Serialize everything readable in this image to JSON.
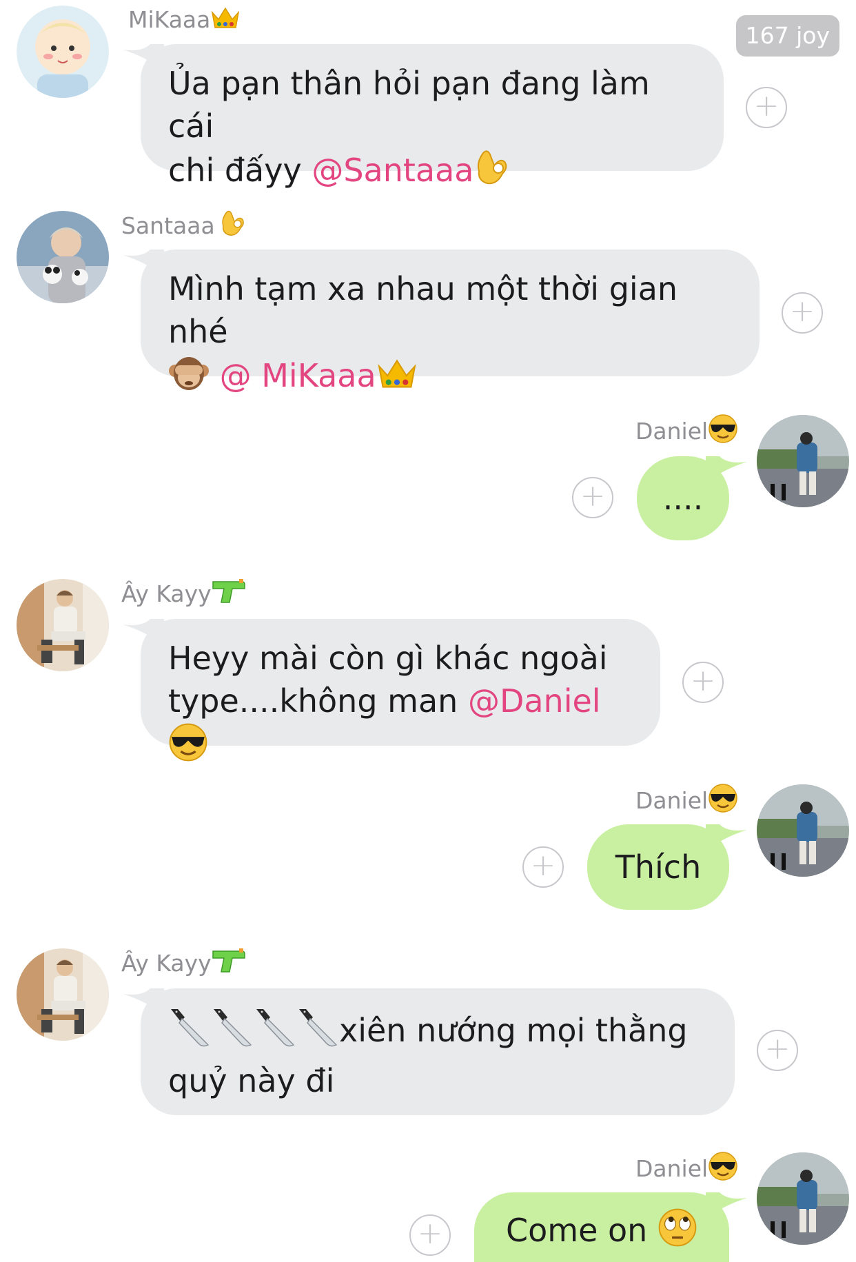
{
  "counter": {
    "label": "167 joy"
  },
  "messages": [
    {
      "sender": "MiKaaa",
      "sender_emoji": "crown-icon",
      "text_line1": "Ủa pạn thân hỏi pạn đang làm cái",
      "text_line2_before": "chi đấyy ",
      "mention": "@Santaaa",
      "mention_emoji": "ok-hand-icon",
      "direction": "in"
    },
    {
      "sender": "Santaaa",
      "sender_emoji": "ok-hand-icon",
      "text_line1": "Mình tạm xa nhau một thời gian nhé",
      "text_line2_before": "",
      "mention": "@ MiKaaa",
      "mention_emoji": "crown-icon",
      "direction": "in"
    },
    {
      "sender": "Daniel",
      "sender_emoji": "sunglasses-face-icon",
      "text": "....",
      "direction": "out"
    },
    {
      "sender": "Ây Kayy",
      "sender_emoji": "water-pistol-icon",
      "text_line1": "Heyy mài còn gì khác ngoài",
      "text_line2_before": "type....không man ",
      "mention": "@Daniel",
      "mention_emoji": "sunglasses-face-icon",
      "direction": "in"
    },
    {
      "sender": "Daniel",
      "sender_emoji": "sunglasses-face-icon",
      "text": "Thích",
      "direction": "out"
    },
    {
      "sender": "Ây Kayy",
      "sender_emoji": "water-pistol-icon",
      "text_line1": "xiên nướng mọi thằng",
      "text_line2": "quỷ này đi",
      "direction": "in"
    },
    {
      "sender": "Daniel",
      "sender_emoji": "sunglasses-face-icon",
      "text": "Come on",
      "text_emoji": "rolling-eyes-face-icon",
      "direction": "out"
    }
  ],
  "add_button_label": "+",
  "colors": {
    "incoming_bubble": "#e9eaec",
    "outgoing_bubble": "#c8f0a0",
    "mention": "#e2457f",
    "sender_name": "#8e8e93"
  }
}
